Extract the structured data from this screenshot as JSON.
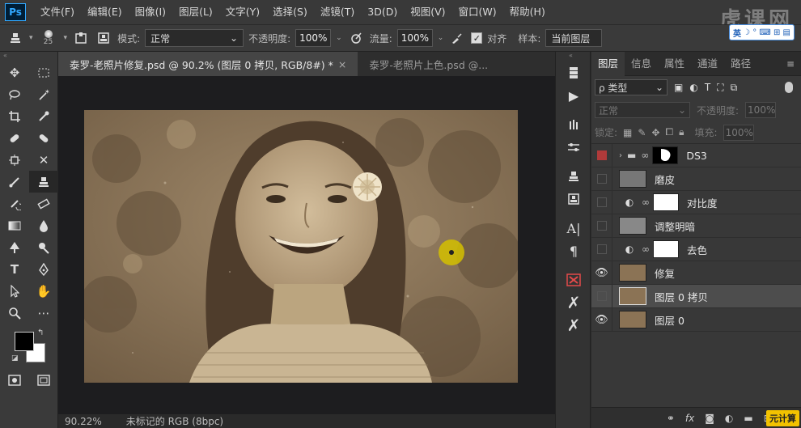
{
  "app": {
    "logo": "Ps",
    "watermark": "虎课网"
  },
  "menu": [
    "文件(F)",
    "编辑(E)",
    "图像(I)",
    "图层(L)",
    "文字(Y)",
    "选择(S)",
    "滤镜(T)",
    "3D(D)",
    "视图(V)",
    "窗口(W)",
    "帮助(H)"
  ],
  "options": {
    "brush_size": "25",
    "mode_label": "模式:",
    "mode_value": "正常",
    "opacity_label": "不透明度:",
    "opacity_value": "100%",
    "flow_label": "流量:",
    "flow_value": "100%",
    "align_label": "对齐",
    "sample_label": "样本:",
    "sample_value": "当前图层"
  },
  "ime": {
    "label": "英",
    "symbols": "☽ ° ⌨ ⊞ ▤"
  },
  "tabs": [
    {
      "label": "泰罗-老照片修复.psd @ 90.2% (图层 0 拷贝, RGB/8#) *",
      "close": "×"
    },
    {
      "label": "泰罗-老照片上色.psd @...",
      "close": ""
    }
  ],
  "status": {
    "zoom": "90.22%",
    "info": "未标记的 RGB (8bpc)"
  },
  "layers_panel": {
    "tabs": [
      "图层",
      "信息",
      "属性",
      "通道",
      "路径"
    ],
    "filter_label": "ρ 类型",
    "blend_mode": "正常",
    "opacity_label": "不透明度:",
    "opacity_value": "100%",
    "lock_label": "锁定:",
    "fill_label": "填充:",
    "fill_value": "100%",
    "layers": [
      {
        "name": "DS3",
        "kind": "group"
      },
      {
        "name": "磨皮",
        "kind": "pixel"
      },
      {
        "name": "对比度",
        "kind": "adjustment"
      },
      {
        "name": "调整明暗",
        "kind": "pixel"
      },
      {
        "name": "去色",
        "kind": "adjustment"
      },
      {
        "name": "修复",
        "kind": "pixel"
      },
      {
        "name": "图层 0 拷贝",
        "kind": "pixel"
      },
      {
        "name": "图层 0",
        "kind": "pixel"
      }
    ],
    "footer_icons": [
      "link-icon",
      "fx-icon",
      "mask-icon",
      "adjustment-icon",
      "folder-icon",
      "new-layer-icon",
      "trash-icon"
    ]
  },
  "brand_badge": "元计算",
  "colors": {
    "accent": "#31a8ff",
    "photo_sepia": "#8b7355",
    "selection_red": "#b03a3a"
  }
}
